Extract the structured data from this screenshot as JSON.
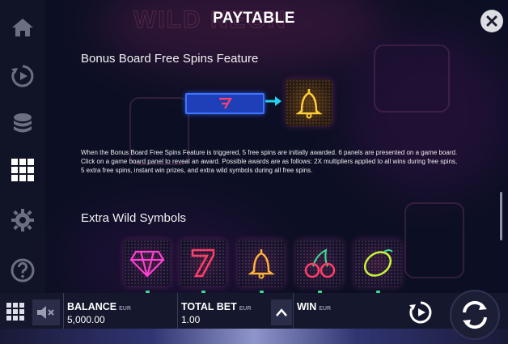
{
  "header": {
    "title": "PAYTABLE"
  },
  "sidebar": {
    "items": [
      {
        "name": "home-icon"
      },
      {
        "name": "autoplay-icon"
      },
      {
        "name": "coins-icon"
      },
      {
        "name": "grid-icon"
      },
      {
        "name": "settings-icon"
      },
      {
        "name": "help-icon"
      }
    ]
  },
  "section1": {
    "title": "Bonus Board Free Spins Feature",
    "description": "When the Bonus Board Free Spins Feature is triggered, 5 free spins are initially awarded. 6 panels are presented on a game board. Click on a game board panel to reveal an award. Possible awards are as follows: 2X multipliers applied to all wins during free spins, 5 extra free spins, instant win prizes, and extra wild symbols during all free spins."
  },
  "section2": {
    "title": "Extra Wild Symbols",
    "symbols": [
      "diamond-symbol",
      "seven-symbol",
      "bell-symbol",
      "cherry-symbol",
      "lemon-symbol"
    ]
  },
  "bottom": {
    "balance_label": "BALANCE",
    "balance_currency": "EUR",
    "balance_value": "5,000.00",
    "bet_label": "TOTAL BET",
    "bet_currency": "EUR",
    "bet_value": "1.00",
    "win_label": "WIN",
    "win_currency": "EUR"
  },
  "colors": {
    "accent_pink": "#ff3fa8",
    "accent_cyan": "#22d3ee",
    "bell_gold": "#ffcf3a",
    "panel_blue": "#2a55d8"
  }
}
